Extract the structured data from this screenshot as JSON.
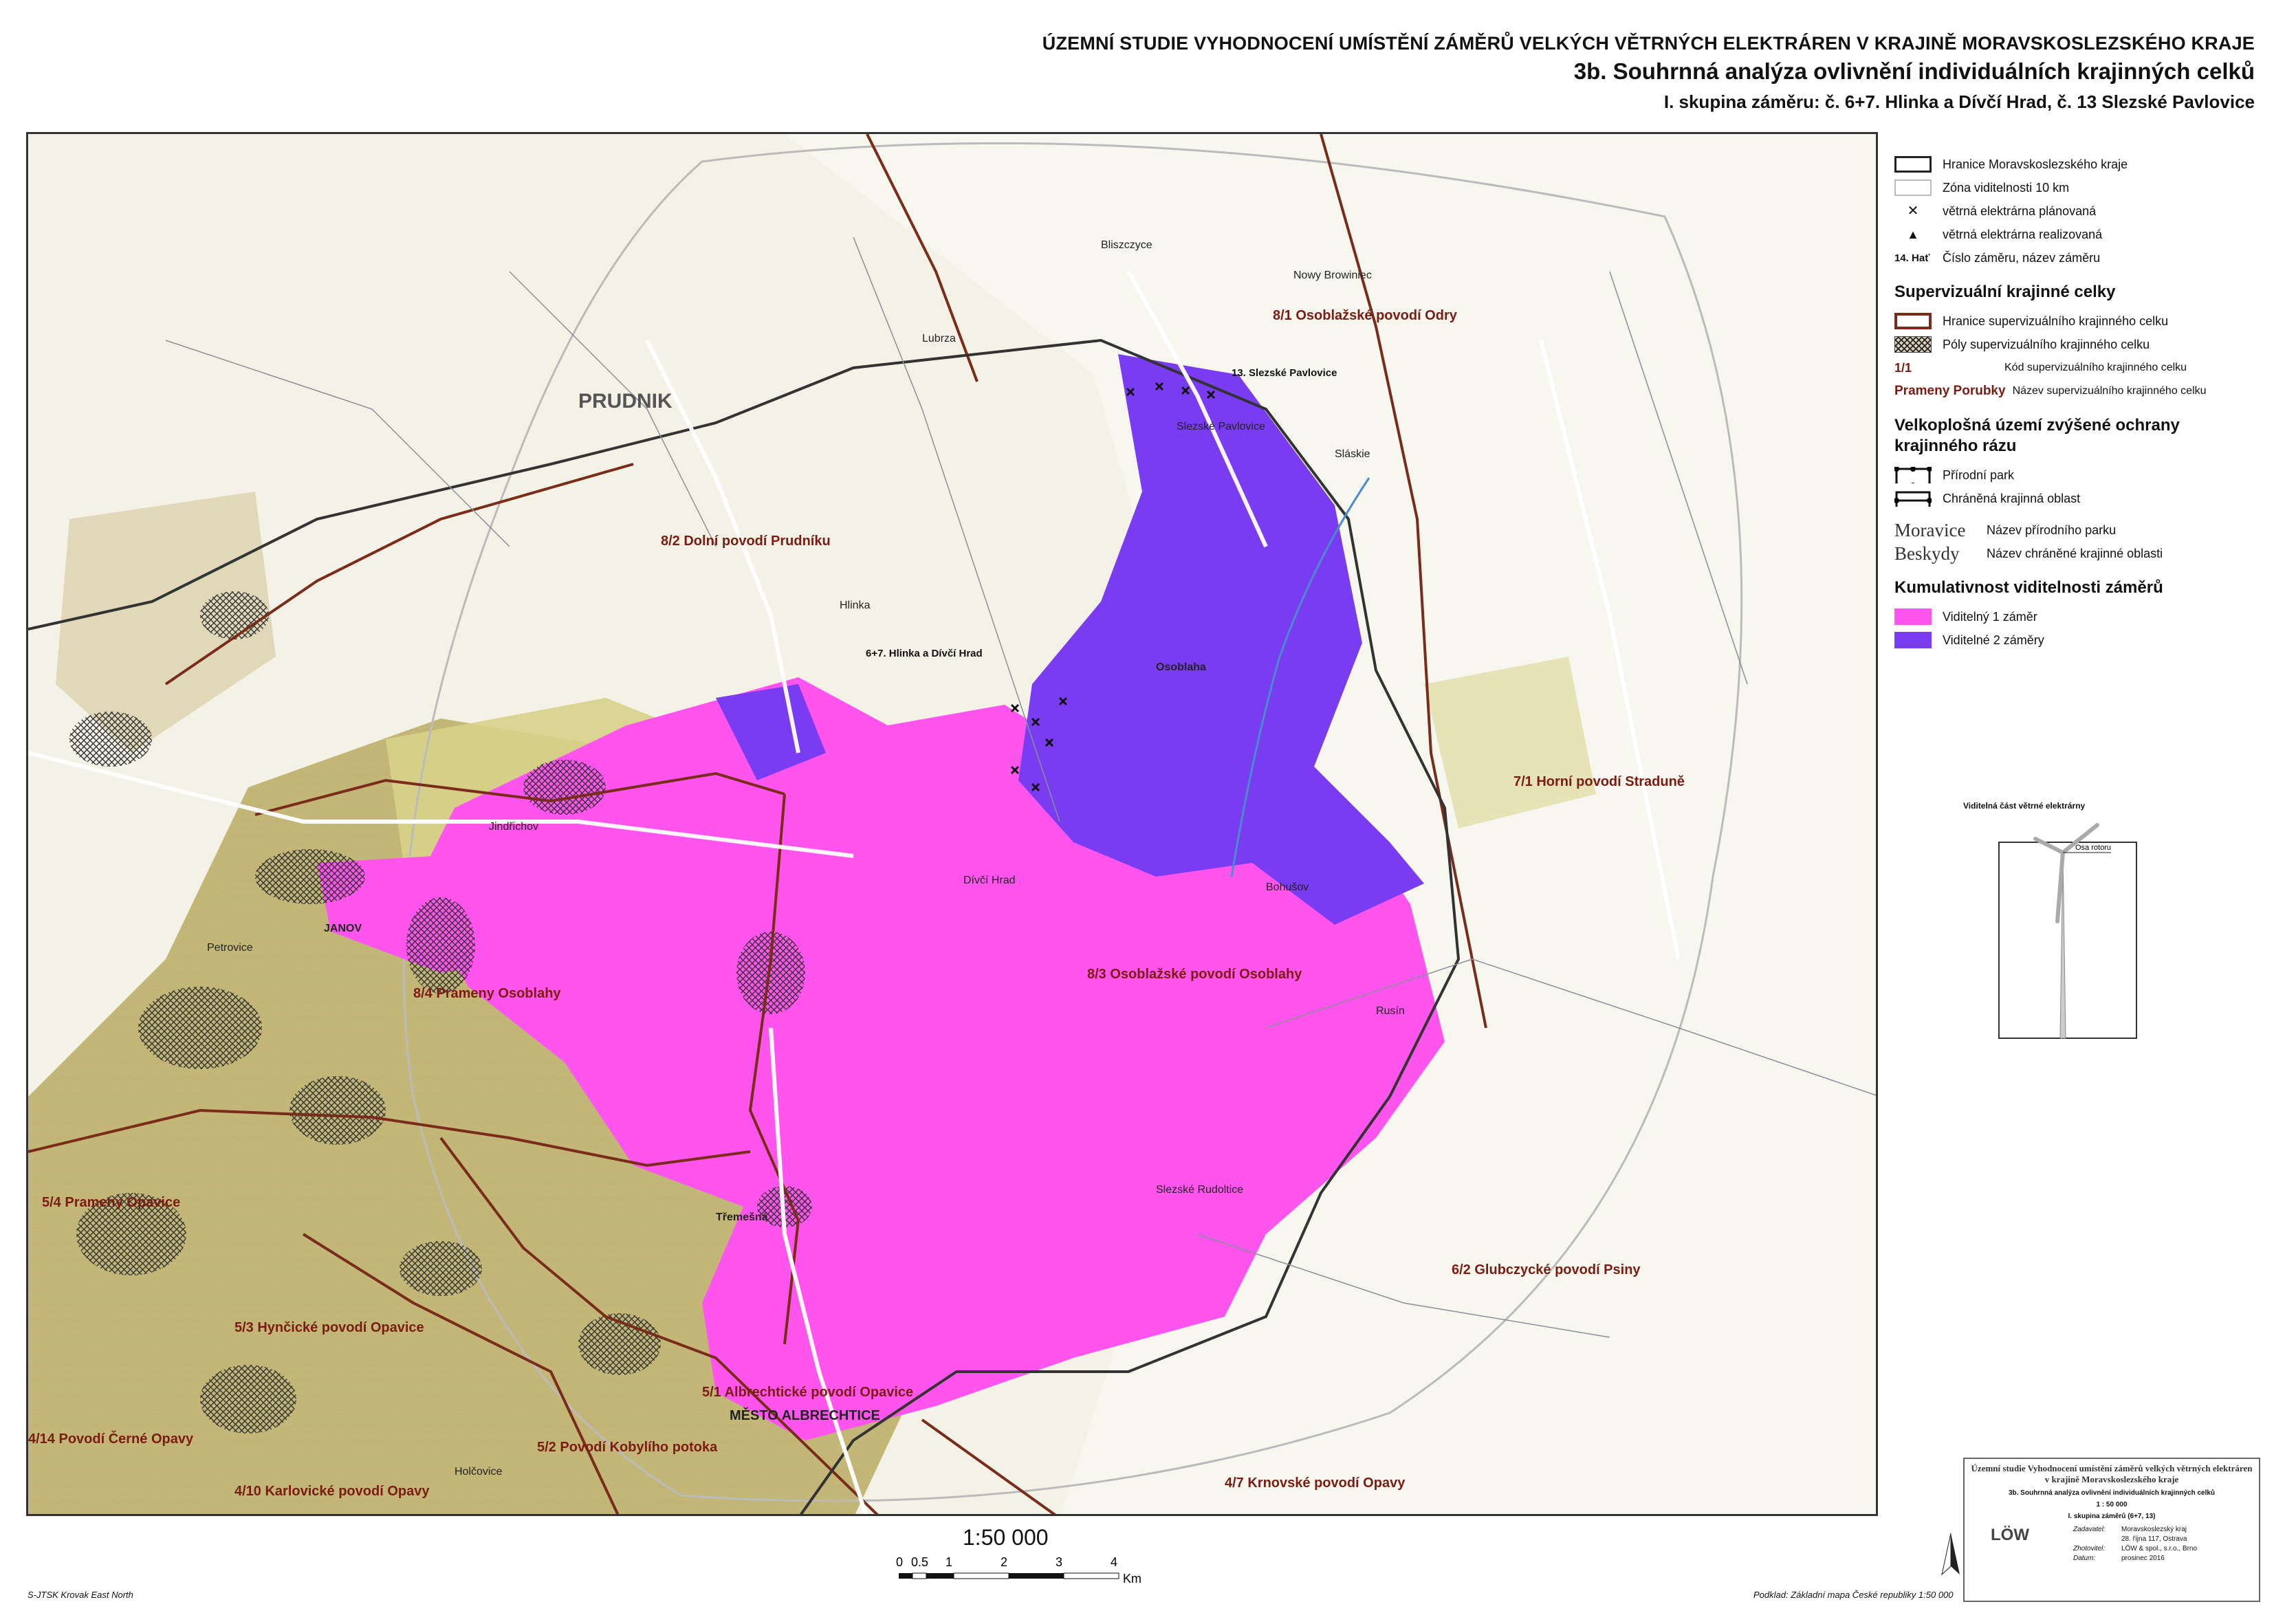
{
  "title": {
    "line1": "ÚZEMNÍ STUDIE VYHODNOCENÍ UMÍSTĚNÍ ZÁMĚRŮ VELKÝCH VĚTRNÝCH ELEKTRÁREN V KRAJINĚ MORAVSKOSLEZSKÉHO KRAJE",
    "line2": "3b. Souhrnná analýza ovlivnění individuálních krajinných celků",
    "line3": "I. skupina záměru: č. 6+7. Hlinka a Dívčí Hrad, č. 13 Slezské Pavlovice"
  },
  "legend": {
    "items_basic": [
      {
        "label": "Hranice Moravskoslezského kraje"
      },
      {
        "label": "Zóna viditelnosti 10 km"
      },
      {
        "label": "větrná elektrárna plánovaná"
      },
      {
        "label": "větrná elektrárna realizovaná"
      }
    ],
    "project_code": "14. Hať",
    "project_code_label": "Číslo záměru, název záměru",
    "section_supervisual": "Supervizuální krajinné celky",
    "supervisual_items": [
      {
        "label": "Hranice supervizuálního krajinného celku"
      },
      {
        "label": "Póly supervizuálního krajinného celku"
      }
    ],
    "unit_code_example": "1/1",
    "unit_code_label": "Kód supervizuálního krajinného celku",
    "unit_name_example": "Prameny Porubky",
    "unit_name_label": "Název supervizuálního krajinného celku",
    "section_protection": "Velkoplošná území zvýšené ochrany krajinného rázu",
    "protection_items": [
      {
        "label": "Přírodní park"
      },
      {
        "label": "Chráněná krajinná oblast"
      }
    ],
    "park_name_example": "Moravice",
    "park_name_label": "Název přírodního parku",
    "cho_name_example": "Beskydy",
    "cho_name_label": "Název chráněné krajinné oblasti",
    "section_cumulative": "Kumulativnost viditelnosti záměrů",
    "cumulative_items": [
      {
        "label": "Viditelný 1 záměr",
        "color": "#ff55ee"
      },
      {
        "label": "Viditelné 2 záměry",
        "color": "#7a3cf0"
      }
    ]
  },
  "turbine_caption": "Viditelná část větrné elektrárny",
  "turbine_rotor_label": "Osa rotoru",
  "map_labels": {
    "units": [
      "8/1 Osoblažské povodí Odry",
      "8/2 Dolní povodí Prudníku",
      "7/1 Horní povodí Straduně",
      "8/3 Osoblažské povodí Osoblahy",
      "8/4 Prameny Osoblahy",
      "5/4 Prameny Opavice",
      "5/3 Hynčické povodí Opavice",
      "5/1 Albrechtické povodí Opavice",
      "6/2 Glubczycké povodí Psiny",
      "4/14 Povodí Černé Opavy",
      "5/2 Povodí Kobylího potoka",
      "4/10 Karlovické povodí Opavy",
      "4/7 Krnovské povodí Opavy"
    ],
    "projects": [
      "13. Slezské Pavlovice",
      "6+7. Hlinka a Dívčí Hrad"
    ],
    "towns": [
      "PRUDNIK",
      "Lubrza",
      "Osoblaha",
      "Třemešná",
      "JANOV",
      "Petrovice",
      "Jindřichov",
      "MĚSTO ALBRECHTICE",
      "Holčovice",
      "Slezské Rudoltice",
      "Nowy Browiniec",
      "Sláskie",
      "Bliszczyce",
      "Hlinka",
      "Dívčí Hrad",
      "Bohušov",
      "Slezské Pavlovice",
      "Rusín"
    ]
  },
  "scale": {
    "label": "1:50 000",
    "ticks": [
      "0",
      "0.5",
      "1",
      "2",
      "3",
      "4"
    ],
    "unit": "Km"
  },
  "projection": "S-JTSK Krovak East North",
  "source": "Podklad: Základní mapa České republiky 1:50 000",
  "cartouche": {
    "title_lines": [
      "Územní studie Vyhodnocení umístění záměrů velkých větrných elektráren",
      "v krajině Moravskoslezského kraje"
    ],
    "subtitle": "3b. Souhrnná analýza ovlivnění individuálních krajinných celků",
    "scale": "1 : 50 000",
    "group": "I. skupina záměrů (6+7, 13)",
    "rows": [
      {
        "k": "Zadavatel:",
        "v": "Moravskoslezský kraj"
      },
      {
        "k": "",
        "v": "28. října 117, Ostrava"
      },
      {
        "k": "Zhotovitel:",
        "v": "LÖW & spol., s.r.o., Brno"
      },
      {
        "k": "Datum:",
        "v": "prosinec 2016"
      }
    ],
    "logo": "LÖW"
  },
  "colors": {
    "visible_one": "#ff55ee",
    "visible_two": "#7a3cf0",
    "unit_boundary": "#7a2c1a",
    "nature_park": "#c9c26a"
  }
}
